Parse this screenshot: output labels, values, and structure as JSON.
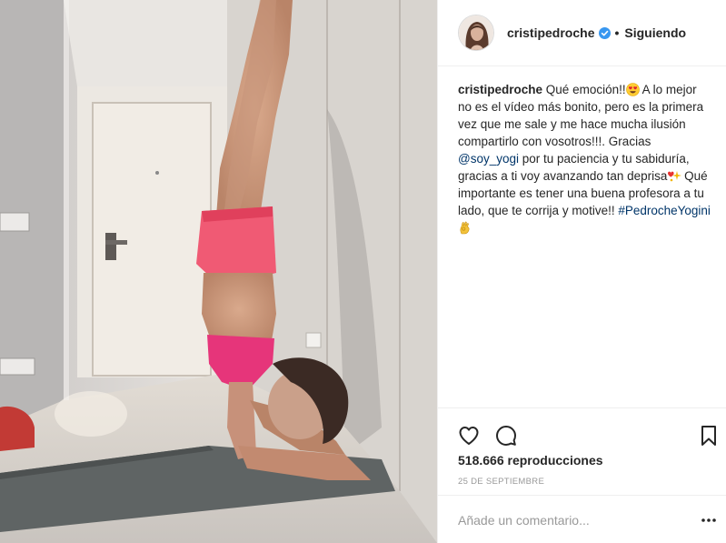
{
  "post": {
    "username": "cristipedroche",
    "follow_status": "Siguiendo",
    "separator": "•",
    "caption": {
      "part1": "Qué emoción!!",
      "part2": " A lo mejor no es el vídeo más bonito, pero es la primera vez que me sale y me hace mucha ilusión compartirlo con vosotros!!!. Gracias ",
      "mention": "@soy_yogi",
      "part3": " por tu paciencia y tu sabiduría, gracias a ti voy avanzando tan deprisa",
      "part4": " Qué importante es tener una buena profesora a tu lado, que te corrija y motive!! ",
      "hashtag": "#PedrocheYogini"
    },
    "views": "518.666 reproducciones",
    "date": "25 DE SEPTIEMBRE",
    "comment_placeholder": "Añade un comentario..."
  },
  "icons": {
    "verified": "verified-badge-icon",
    "like": "heart-icon",
    "comment": "comment-bubble-icon",
    "save": "bookmark-icon",
    "more": "more-options-icon"
  },
  "colors": {
    "verified_blue": "#3897f0",
    "link": "#003569",
    "text": "#262626",
    "muted": "#999999",
    "border": "#efefef"
  }
}
